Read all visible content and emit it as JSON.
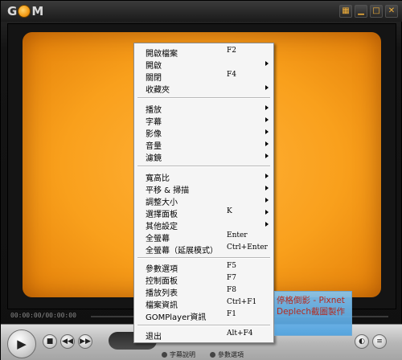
{
  "app": {
    "logo_left": "G",
    "logo_right": "M"
  },
  "window_controls": [
    {
      "name": "grid-icon",
      "glyph": "▦"
    },
    {
      "name": "minimize-icon",
      "glyph": "▁"
    },
    {
      "name": "maximize-icon",
      "glyph": "□"
    },
    {
      "name": "close-icon",
      "glyph": "✕"
    }
  ],
  "playback": {
    "time": "00:00:00/00:00:00"
  },
  "controls": {
    "play_glyph": "▶",
    "stop_glyph": "■",
    "prev_glyph": "◀◀",
    "next_glyph": "▶▶",
    "pref_glyph": "◐",
    "eq_glyph": "≡"
  },
  "bottom_links": {
    "subtitle_label": "字幕說明",
    "options_label": "參數選項"
  },
  "context_menu": {
    "items": [
      {
        "label": "開啟檔案",
        "shortcut": "F2",
        "submenu": false
      },
      {
        "label": "開啟",
        "shortcut": "",
        "submenu": true
      },
      {
        "label": "關閉",
        "shortcut": "F4",
        "submenu": false
      },
      {
        "label": "收藏夾",
        "shortcut": "",
        "submenu": true
      },
      {
        "label": "播放",
        "shortcut": "",
        "submenu": true
      },
      {
        "label": "字幕",
        "shortcut": "",
        "submenu": true
      },
      {
        "label": "影像",
        "shortcut": "",
        "submenu": true
      },
      {
        "label": "音量",
        "shortcut": "",
        "submenu": true
      },
      {
        "label": "濾鏡",
        "shortcut": "",
        "submenu": true
      },
      {
        "label": "寬高比",
        "shortcut": "",
        "submenu": true
      },
      {
        "label": "平移 & 掃描",
        "shortcut": "",
        "submenu": true
      },
      {
        "label": "調整大小",
        "shortcut": "",
        "submenu": true
      },
      {
        "label": "選擇面板",
        "shortcut": "K",
        "submenu": true
      },
      {
        "label": "其他設定",
        "shortcut": "",
        "submenu": true
      },
      {
        "label": "全螢幕",
        "shortcut": "Enter",
        "submenu": false
      },
      {
        "label": "全螢幕（延展模式）",
        "shortcut": "Ctrl+Enter",
        "submenu": false
      },
      {
        "label": "參數選項",
        "shortcut": "F5",
        "submenu": false
      },
      {
        "label": "控制面板",
        "shortcut": "F7",
        "submenu": false
      },
      {
        "label": "播放列表",
        "shortcut": "F8",
        "submenu": false
      },
      {
        "label": "檔案資訊",
        "shortcut": "Ctrl+F1",
        "submenu": false
      },
      {
        "label": "GOMPlayer資訊",
        "shortcut": "F1",
        "submenu": false
      },
      {
        "label": "退出",
        "shortcut": "Alt+F4",
        "submenu": false
      }
    ]
  },
  "watermark": {
    "line1": "停格倒影 - Pixnet",
    "line2": "Deplech截圖製作"
  }
}
